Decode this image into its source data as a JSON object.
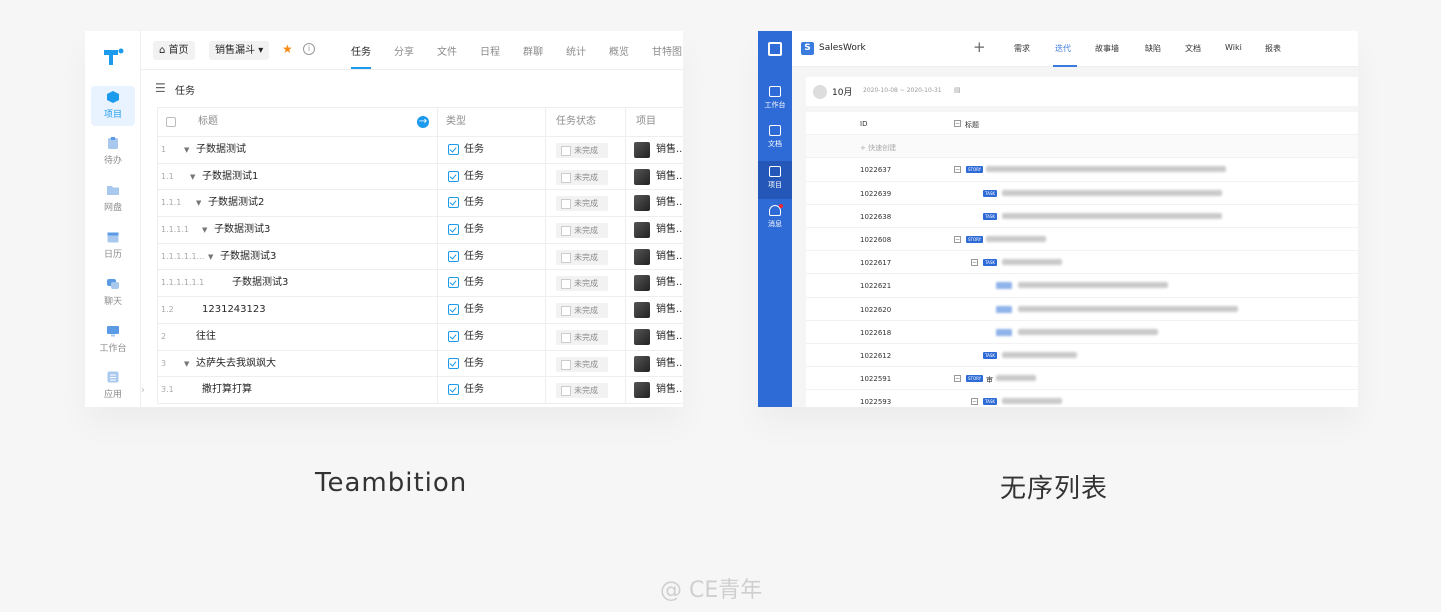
{
  "left": {
    "sidebar": [
      {
        "label": "项目",
        "icon": "cube-icon",
        "active": true
      },
      {
        "label": "待办",
        "icon": "clipboard-icon"
      },
      {
        "label": "网盘",
        "icon": "folder-icon"
      },
      {
        "label": "日历",
        "icon": "calendar-icon"
      },
      {
        "label": "聊天",
        "icon": "chat-icon"
      },
      {
        "label": "工作台",
        "icon": "monitor-icon"
      },
      {
        "label": "应用",
        "icon": "apps-icon"
      }
    ],
    "header": {
      "home": "首页",
      "project": "销售漏斗",
      "tabs": [
        "任务",
        "分享",
        "文件",
        "日程",
        "群聊",
        "统计",
        "概览",
        "甘特图"
      ]
    },
    "subbar_title": "任务",
    "table": {
      "columns": [
        "标题",
        "类型",
        "任务状态",
        "项目"
      ],
      "rows": [
        {
          "num": "1",
          "title": "子数据测试",
          "type": "任务",
          "status": "未完成",
          "project": "销售..."
        },
        {
          "num": "1.1",
          "title": "子数据测试1",
          "type": "任务",
          "status": "未完成",
          "project": "销售..."
        },
        {
          "num": "1.1.1",
          "title": "子数据测试2",
          "type": "任务",
          "status": "未完成",
          "project": "销售..."
        },
        {
          "num": "1.1.1.1",
          "title": "子数据测试3",
          "type": "任务",
          "status": "未完成",
          "project": "销售..."
        },
        {
          "num": "1.1.1.1.1...",
          "title": "子数据测试3",
          "type": "任务",
          "status": "未完成",
          "project": "销售..."
        },
        {
          "num": "1.1.1.1.1.1",
          "title": "子数据测试3",
          "type": "任务",
          "status": "未完成",
          "project": "销售..."
        },
        {
          "num": "1.2",
          "title": "1231243123",
          "type": "任务",
          "status": "未完成",
          "project": "销售..."
        },
        {
          "num": "2",
          "title": "往往",
          "type": "任务",
          "status": "未完成",
          "project": "销售..."
        },
        {
          "num": "3",
          "title": "达萨失去我飒飒大",
          "type": "任务",
          "status": "未完成",
          "project": "销售..."
        },
        {
          "num": "3.1",
          "title": "撒打算打算",
          "type": "任务",
          "status": "未完成",
          "project": "销售..."
        }
      ]
    }
  },
  "right": {
    "app_name": "SalesWork",
    "app_icon_letter": "S",
    "sidebar": [
      {
        "label": "工作台",
        "icon": "archive-icon"
      },
      {
        "label": "文档",
        "icon": "document-icon"
      },
      {
        "label": "项目",
        "icon": "mail-icon",
        "active": true
      },
      {
        "label": "消息",
        "icon": "bell-icon"
      }
    ],
    "tabs": [
      "需求",
      "迭代",
      "故事墙",
      "缺陷",
      "文档",
      "Wiki",
      "报表"
    ],
    "iteration": {
      "month": "10月",
      "range": "2020-10-08 ~ 2020-10-31"
    },
    "list": {
      "columns": [
        "ID",
        "标题"
      ],
      "quick_create": "+ 快速创建",
      "rows": [
        {
          "id": "1022637",
          "tag": "STORY"
        },
        {
          "id": "1022639",
          "tag": "TASK"
        },
        {
          "id": "1022638",
          "tag": "TASK"
        },
        {
          "id": "1022608",
          "tag": "STORY"
        },
        {
          "id": "1022617",
          "tag": "TASK"
        },
        {
          "id": "1022621"
        },
        {
          "id": "1022620"
        },
        {
          "id": "1022618"
        },
        {
          "id": "1022612",
          "tag": "TASK"
        },
        {
          "id": "1022591",
          "tag": "STORY",
          "title_prefix": "审"
        },
        {
          "id": "1022593",
          "tag": "TASK"
        }
      ]
    }
  },
  "captions": {
    "left": "Teambition",
    "right": "无序列表"
  },
  "watermark": "@ CE青年",
  "colors": {
    "teambition_blue": "#1b9aee",
    "saleswork_blue": "#2f6bd6",
    "star": "#fa8c16"
  }
}
